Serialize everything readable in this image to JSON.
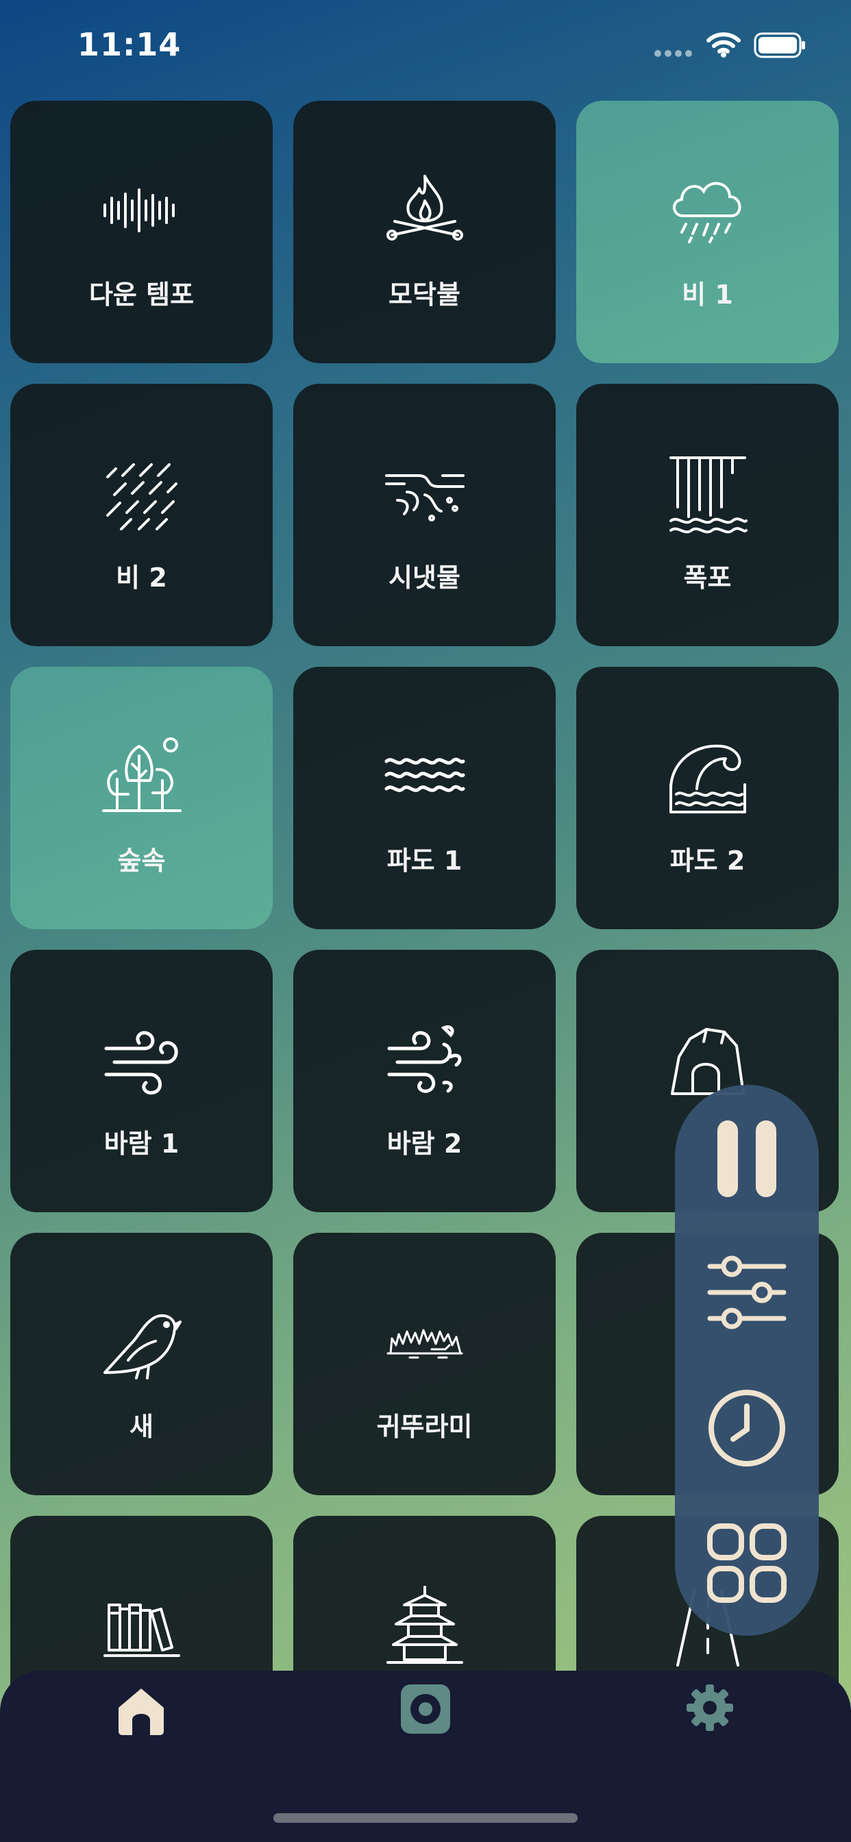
{
  "status_bar": {
    "time": "11:14",
    "wifi_icon": "wifi-icon",
    "battery_icon": "battery-icon"
  },
  "sounds": [
    {
      "label": "다운 템포",
      "icon": "soundwave-icon",
      "active": false
    },
    {
      "label": "모닥불",
      "icon": "campfire-icon",
      "active": false
    },
    {
      "label": "비 1",
      "icon": "rain-cloud-icon",
      "active": true
    },
    {
      "label": "비 2",
      "icon": "rain-icon",
      "active": false
    },
    {
      "label": "시냇물",
      "icon": "stream-icon",
      "active": false
    },
    {
      "label": "폭포",
      "icon": "waterfall-icon",
      "active": false
    },
    {
      "label": "숲속",
      "icon": "forest-icon",
      "active": true
    },
    {
      "label": "파도 1",
      "icon": "waves-icon",
      "active": false
    },
    {
      "label": "파도 2",
      "icon": "big-wave-icon",
      "active": false
    },
    {
      "label": "바람 1",
      "icon": "wind-icon",
      "active": false
    },
    {
      "label": "바람 2",
      "icon": "wind-leaves-icon",
      "active": false
    },
    {
      "label": "",
      "icon": "cave-icon",
      "active": false
    },
    {
      "label": "새",
      "icon": "bird-icon",
      "active": false
    },
    {
      "label": "귀뚜라미",
      "icon": "grass-icon",
      "active": false
    },
    {
      "label": "",
      "icon": "",
      "active": false
    },
    {
      "label": "",
      "icon": "books-icon",
      "active": false
    },
    {
      "label": "",
      "icon": "pagoda-icon",
      "active": false
    },
    {
      "label": "",
      "icon": "road-icon",
      "active": false
    }
  ],
  "controls": {
    "pause_icon": "pause-icon",
    "mixer_icon": "sliders-icon",
    "timer_icon": "clock-icon",
    "grid_icon": "grid-icon"
  },
  "tabs": [
    {
      "name": "home",
      "icon": "home-icon",
      "active": true
    },
    {
      "name": "player",
      "icon": "speaker-icon",
      "active": false
    },
    {
      "name": "settings",
      "icon": "gear-icon",
      "active": false
    }
  ],
  "colors": {
    "active_tile": "#56a696",
    "tile": "#121c20",
    "accent": "#efe3cf",
    "panel": "#375270",
    "tabbar": "#171b33"
  }
}
